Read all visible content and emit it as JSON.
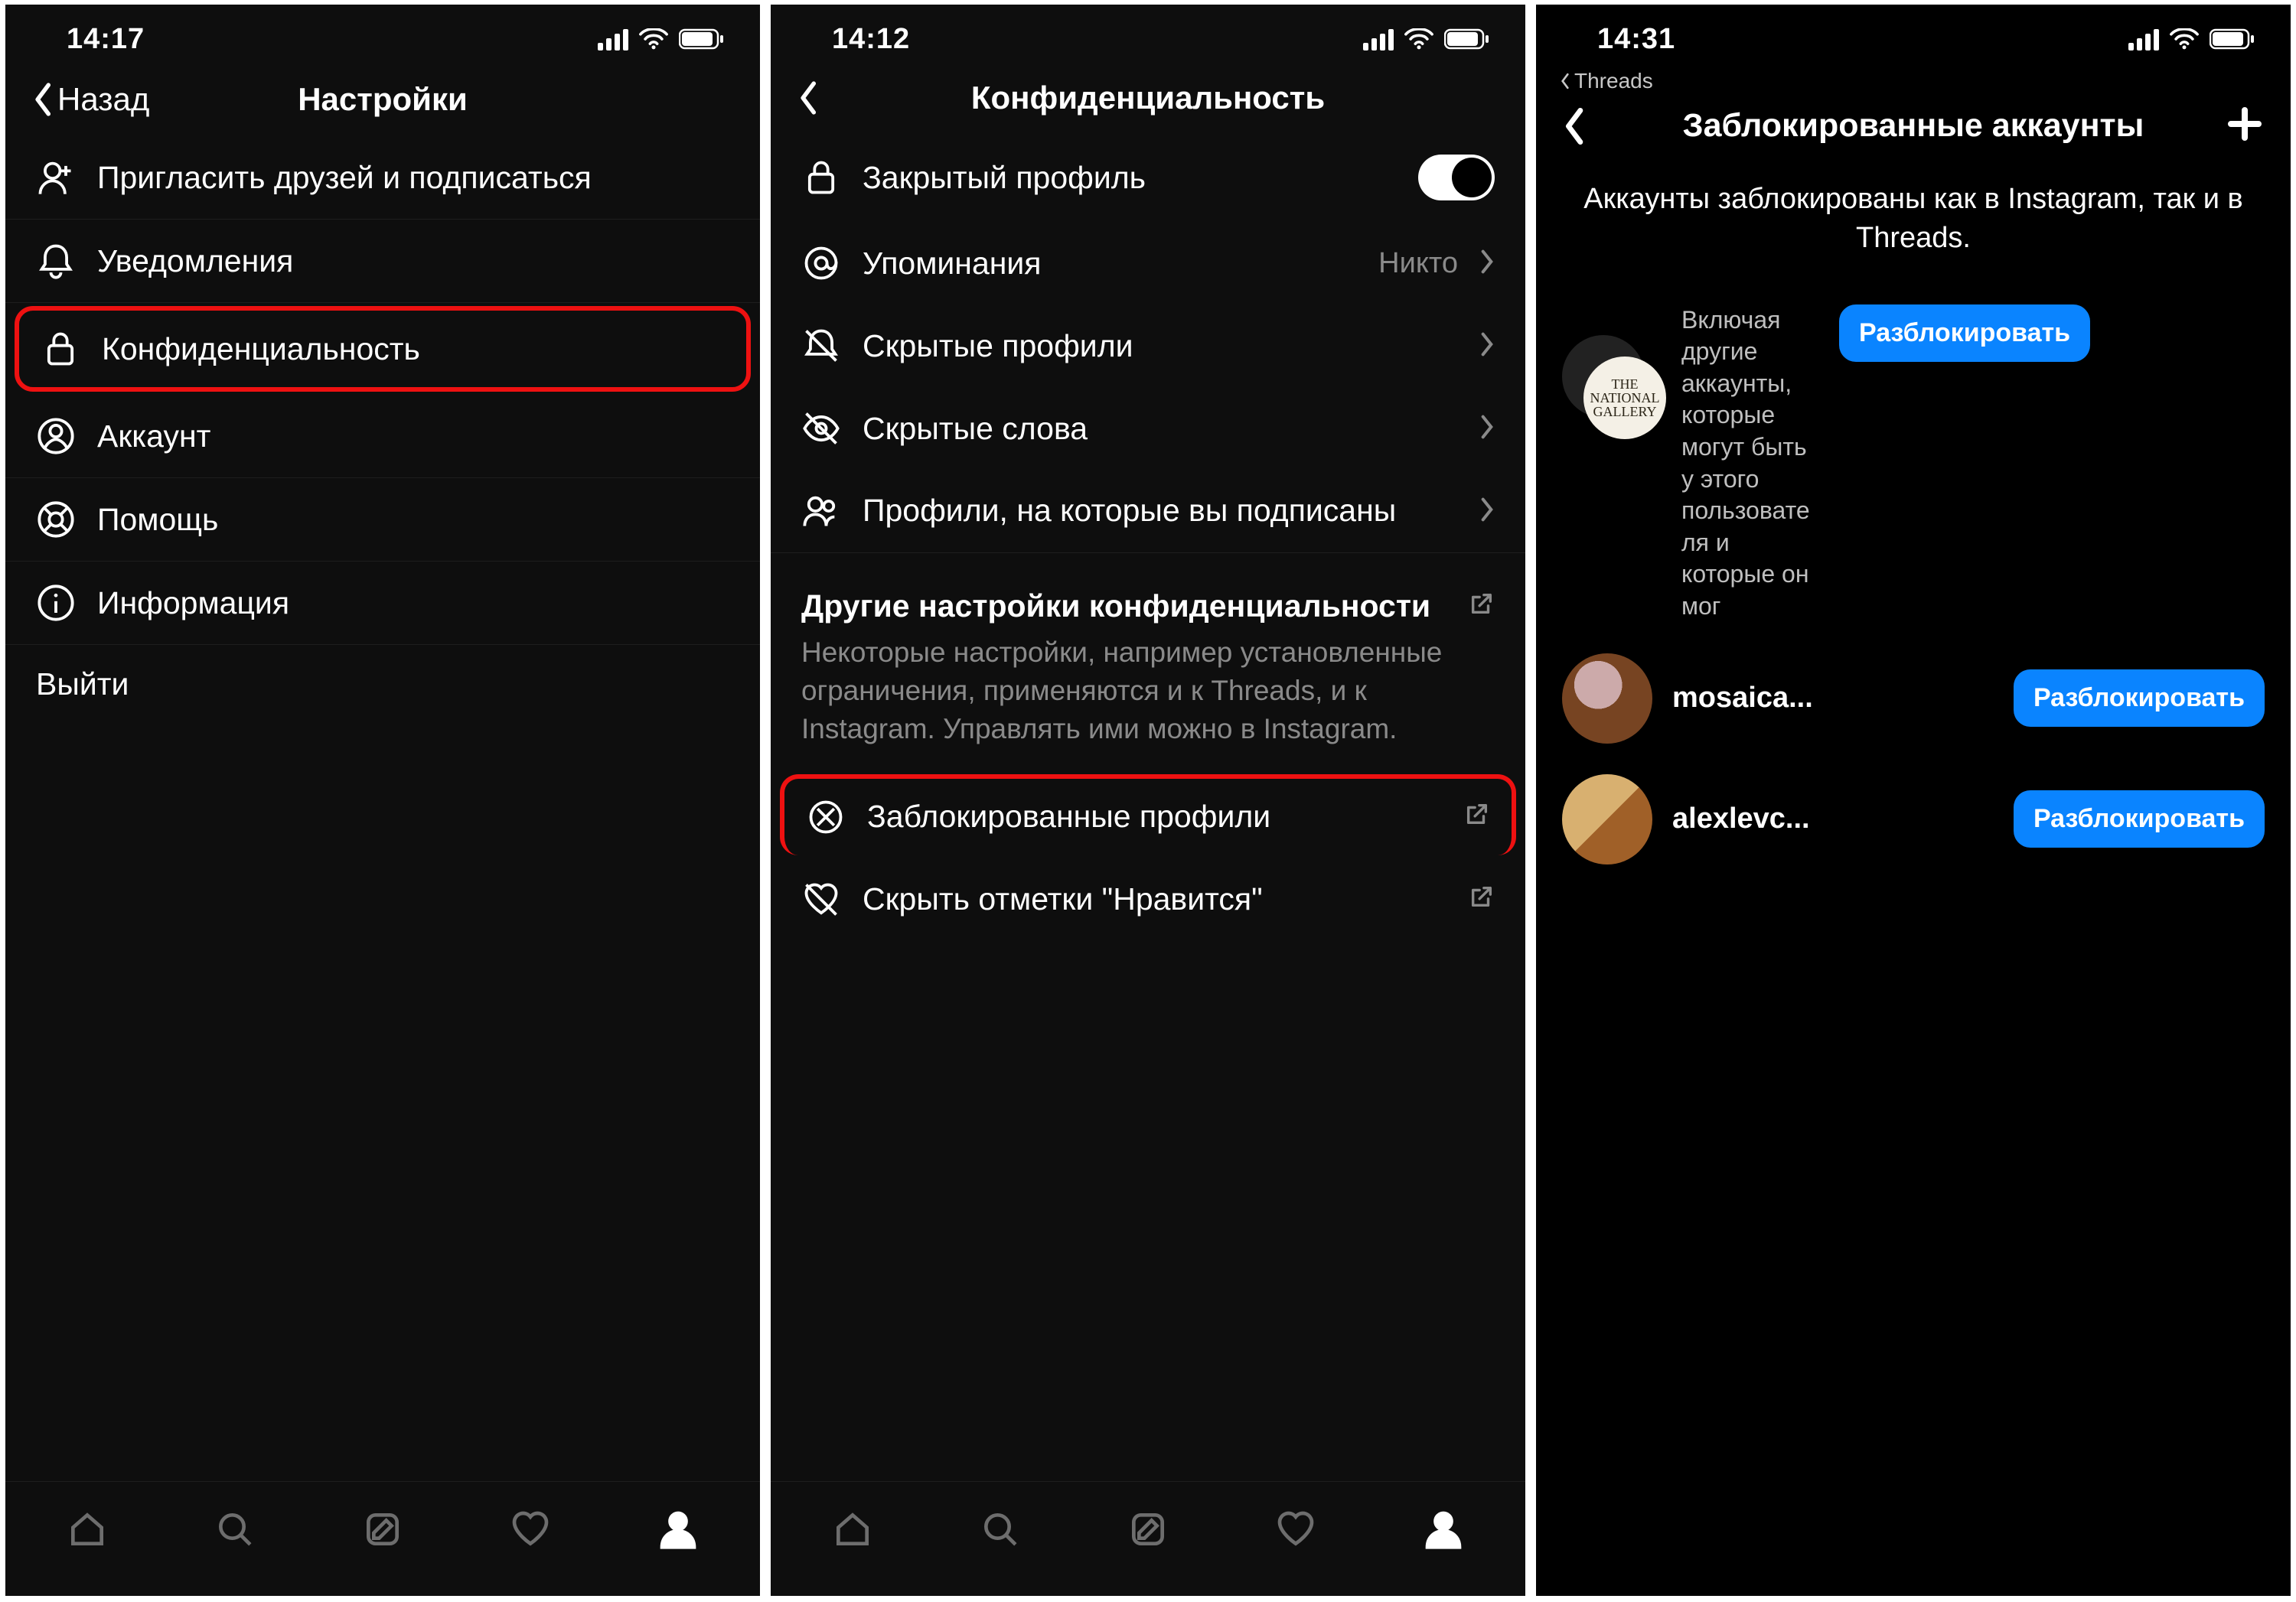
{
  "screen1": {
    "statusbar": {
      "time": "14:17"
    },
    "header": {
      "back": "Назад",
      "title": "Настройки"
    },
    "rows": {
      "invite": "Пригласить друзей и подписаться",
      "notify": "Уведомления",
      "privacy": "Конфиденциальность",
      "account": "Аккаунт",
      "help": "Помощь",
      "info": "Информация",
      "logout": "Выйти"
    }
  },
  "screen2": {
    "statusbar": {
      "time": "14:12"
    },
    "header": {
      "title": "Конфиденциальность"
    },
    "rows": {
      "private_profile": "Закрытый профиль",
      "mentions_label": "Упоминания",
      "mentions_value": "Никто",
      "hidden_profiles": "Скрытые профили",
      "hidden_words": "Скрытые слова",
      "following": "Профили, на которые вы подписаны"
    },
    "section": {
      "title": "Другие настройки конфиденциальности",
      "desc": "Некоторые настройки, например установленные ограничения, применяются и к Threads, и к Instagram. Управлять ими можно в Instagram.",
      "blocked": "Заблокированные профили",
      "hide_likes": "Скрыть отметки \"Нравится\""
    }
  },
  "screen3": {
    "statusbar": {
      "time": "14:31"
    },
    "breadcrumb": "Threads",
    "header": {
      "title": "Заблокированные аккаунты"
    },
    "banner": "Аккаунты заблокированы как в Instagram, так и в Threads.",
    "accounts": [
      {
        "sub": "Включая другие аккаунты, которые могут быть у этого пользователя и которые он мог",
        "avatar_text": "THE NATIONAL GALLERY",
        "button": "Разблокировать"
      },
      {
        "name": "mosaica...",
        "button": "Разблокировать"
      },
      {
        "name": "alexlevc...",
        "button": "Разблокировать"
      }
    ]
  }
}
